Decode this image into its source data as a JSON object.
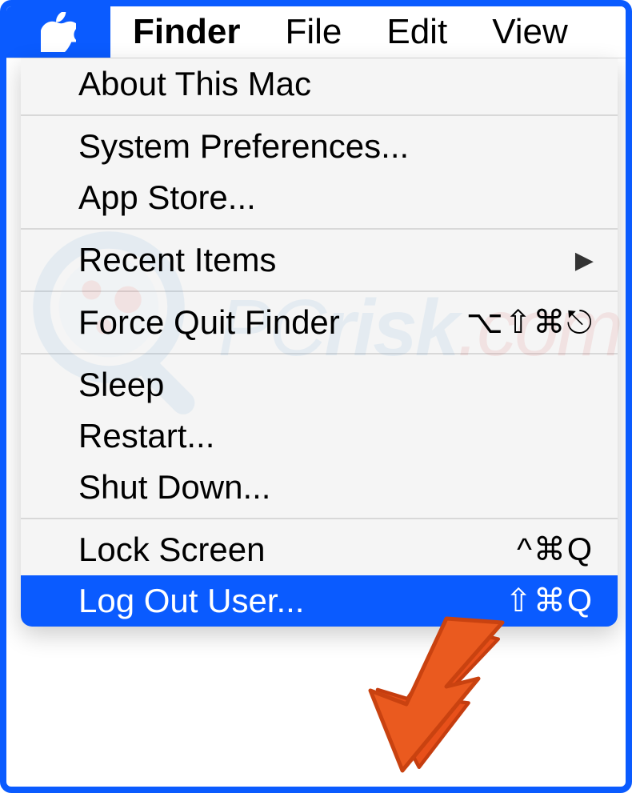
{
  "menubar": {
    "active_app": "Finder",
    "items": [
      "File",
      "Edit",
      "View"
    ]
  },
  "apple_menu": {
    "about": "About This Mac",
    "sysprefs": "System Preferences...",
    "appstore": "App Store...",
    "recent": "Recent Items",
    "force_quit": {
      "label": "Force Quit Finder",
      "shortcut": "⌥⇧⌘⎋"
    },
    "sleep": "Sleep",
    "restart": "Restart...",
    "shutdown": "Shut Down...",
    "lock": {
      "label": "Lock Screen",
      "shortcut": "^⌘Q"
    },
    "logout": {
      "label": "Log Out User...",
      "shortcut": "⇧⌘Q"
    }
  },
  "annotation": {
    "arrow_target": "logout"
  }
}
